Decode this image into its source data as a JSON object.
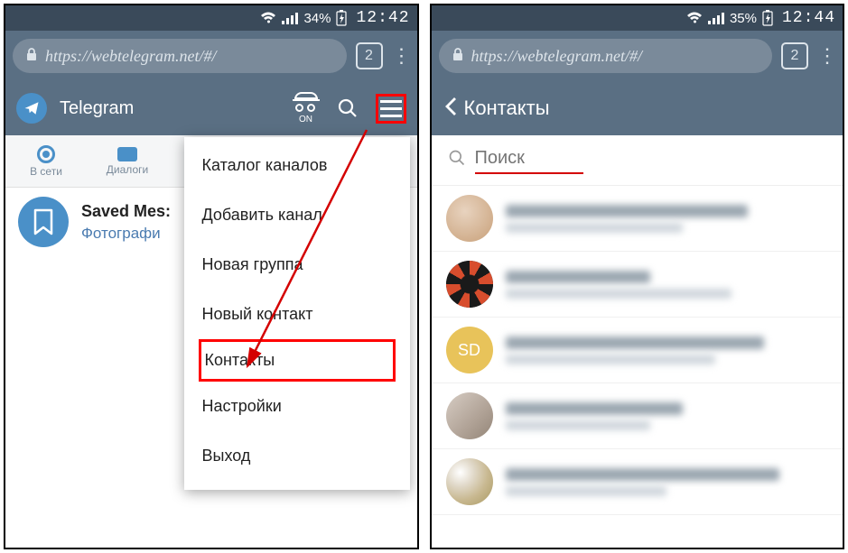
{
  "left": {
    "status": {
      "battery": "34%",
      "time": "12:42"
    },
    "browser": {
      "url": "https://webtelegram.net/#/",
      "tab_count": "2"
    },
    "header": {
      "title": "Telegram",
      "incognito_label": "ON"
    },
    "tabs": {
      "online": "В сети",
      "dialogs": "Диалоги"
    },
    "chat": {
      "name": "Saved Mes:",
      "subtitle": "Фотографи"
    },
    "menu": {
      "channels_catalog": "Каталог каналов",
      "add_channel": "Добавить канал",
      "new_group": "Новая группа",
      "new_contact": "Новый контакт",
      "contacts": "Контакты",
      "settings": "Настройки",
      "logout": "Выход"
    }
  },
  "right": {
    "status": {
      "battery": "35%",
      "time": "12:44"
    },
    "browser": {
      "url": "https://webtelegram.net/#/",
      "tab_count": "2"
    },
    "header": {
      "title": "Контакты"
    },
    "search": {
      "placeholder": "Поиск"
    },
    "avatar3_initials": "SD"
  }
}
